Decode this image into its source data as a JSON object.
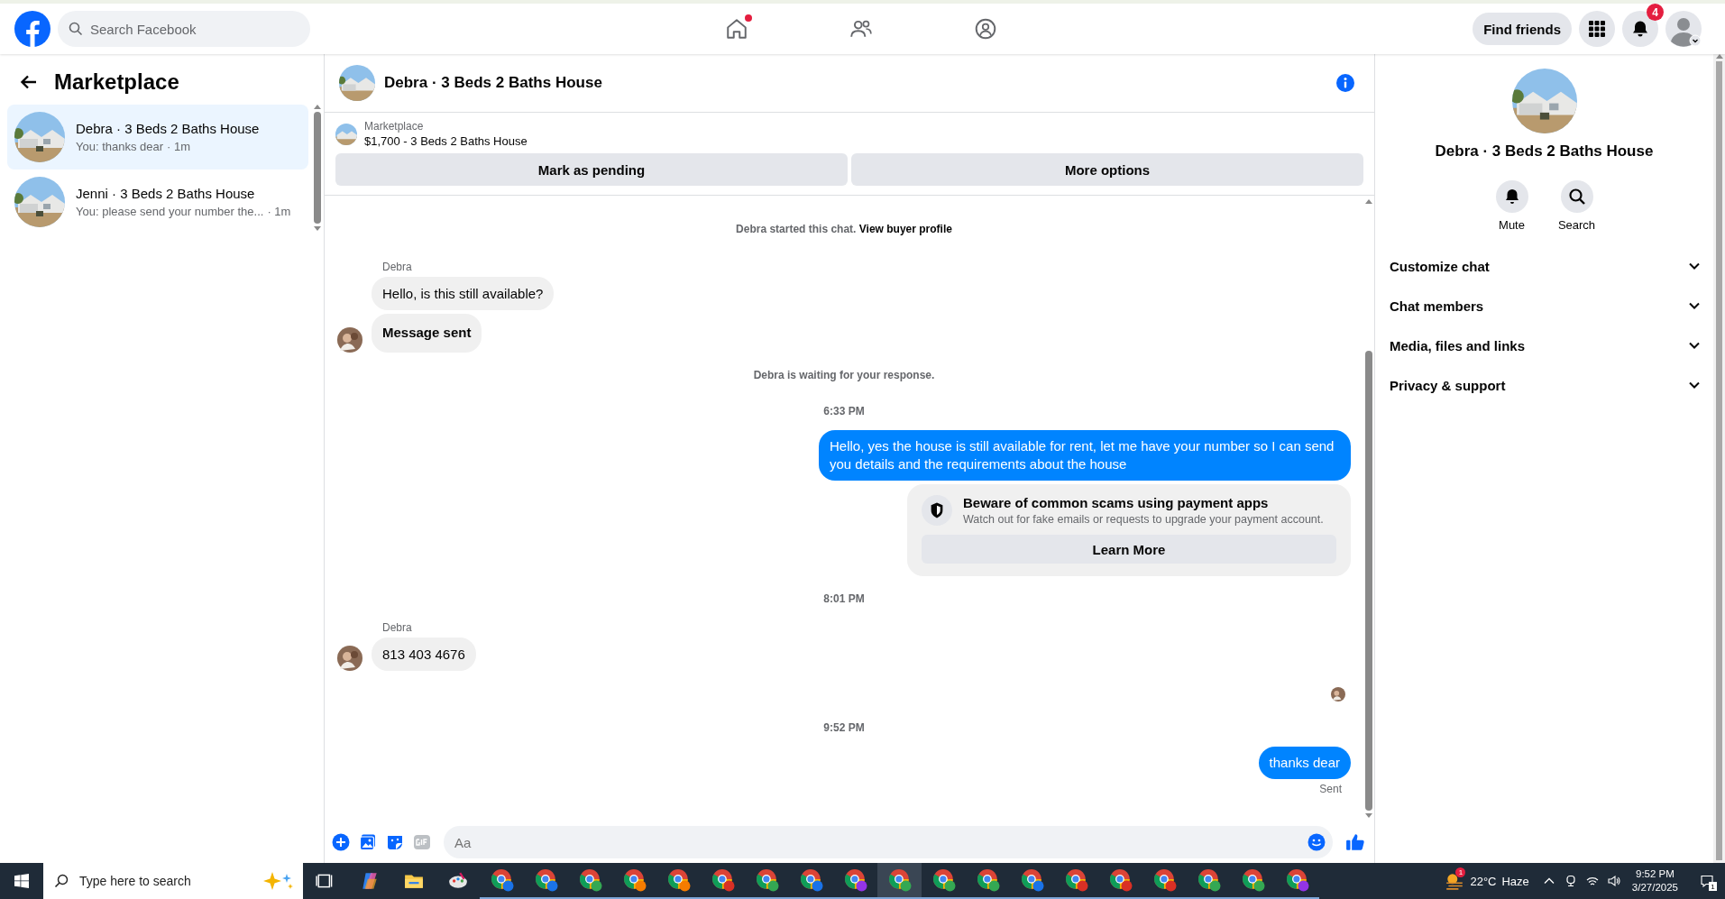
{
  "top_bar": {
    "search": {
      "placeholder": "Search Facebook"
    },
    "nav": [
      {
        "kind": "home",
        "notified": true
      },
      {
        "kind": "friends",
        "notified": false
      },
      {
        "kind": "groups",
        "notified": false
      }
    ],
    "find_friends": "Find friends",
    "notification_count": "4"
  },
  "sidebar": {
    "title": "Marketplace",
    "conversations": [
      {
        "name": "Debra · 3 Beds 2 Baths House",
        "preview": "You: thanks dear",
        "time": "· 1m",
        "selected": true
      },
      {
        "name": "Jenni · 3 Beds 2 Baths House",
        "preview": "You: please send your number the...",
        "time": "· 1m",
        "selected": false
      }
    ]
  },
  "chat": {
    "title": "Debra · 3 Beds 2 Baths House",
    "listing": {
      "label": "Marketplace",
      "item": "$1,700 - 3 Beds 2 Baths House",
      "actions": [
        "Mark as pending",
        "More options"
      ]
    },
    "messages": [
      {
        "kind": "notice",
        "text": "Debra started this chat.",
        "link": "View buyer profile"
      },
      {
        "kind": "sender",
        "text": "Debra"
      },
      {
        "kind": "incoming",
        "text": "Hello, is this still available?",
        "bold": false,
        "avatar": false
      },
      {
        "kind": "incoming",
        "text": "Message sent",
        "bold": true,
        "avatar": true
      },
      {
        "kind": "notice",
        "text": "Debra is waiting for your response."
      },
      {
        "kind": "time",
        "text": "6:33 PM"
      },
      {
        "kind": "outgoing",
        "text": "Hello, yes the house is still available for rent, let me have your number so I can send you details and the requirements about the house"
      },
      {
        "kind": "warning",
        "title": "Beware of common scams using payment apps",
        "text": "Watch out for fake emails or requests to upgrade your payment account.",
        "button": "Learn More"
      },
      {
        "kind": "time",
        "text": "8:01 PM"
      },
      {
        "kind": "sender",
        "text": "Debra"
      },
      {
        "kind": "incoming",
        "text": "813 403 4676",
        "bold": false,
        "avatar": true
      },
      {
        "kind": "read_receipt"
      },
      {
        "kind": "time",
        "text": "9:52 PM"
      },
      {
        "kind": "outgoing",
        "text": "thanks dear"
      },
      {
        "kind": "status",
        "text": "Sent"
      }
    ],
    "composer": {
      "placeholder": "Aa"
    }
  },
  "details": {
    "title": "Debra · 3 Beds 2 Baths House",
    "actions": [
      {
        "kind": "mute",
        "label": "Mute"
      },
      {
        "kind": "search",
        "label": "Search"
      }
    ],
    "sections": [
      {
        "label": "Customize chat",
        "expanded": false
      },
      {
        "label": "Chat members",
        "expanded": false
      },
      {
        "label": "Media, files and links",
        "expanded": false
      },
      {
        "label": "Privacy & support",
        "expanded": false
      }
    ]
  },
  "taskbar": {
    "search": {
      "placeholder": "Type here to search"
    },
    "browser_windows": [
      {
        "color": "#1a73e8",
        "selected": false
      },
      {
        "color": "#1a73e8",
        "selected": false
      },
      {
        "color": "#34a853",
        "selected": false
      },
      {
        "color": "#f57c00",
        "selected": false
      },
      {
        "color": "#f57c00",
        "selected": false
      },
      {
        "color": "#d93025",
        "selected": false
      },
      {
        "color": "#34a853",
        "selected": false
      },
      {
        "color": "#1a73e8",
        "selected": false
      },
      {
        "color": "#9334e6",
        "selected": false
      },
      {
        "color": "#34a853",
        "selected": true
      },
      {
        "color": "#34a853",
        "selected": false
      },
      {
        "color": "#34a853",
        "selected": false
      },
      {
        "color": "#1a73e8",
        "selected": false
      },
      {
        "color": "#d93025",
        "selected": false
      },
      {
        "color": "#d93025",
        "selected": false
      },
      {
        "color": "#d93025",
        "selected": false
      },
      {
        "color": "#34a853",
        "selected": false
      },
      {
        "color": "#34a853",
        "selected": false
      },
      {
        "color": "#9334e6",
        "selected": false
      }
    ],
    "weather": {
      "temperature": "22°C",
      "condition": "Haze",
      "alert_count": "1"
    },
    "time": "9:52 PM",
    "date": "3/27/2025",
    "notification_count": "1"
  }
}
